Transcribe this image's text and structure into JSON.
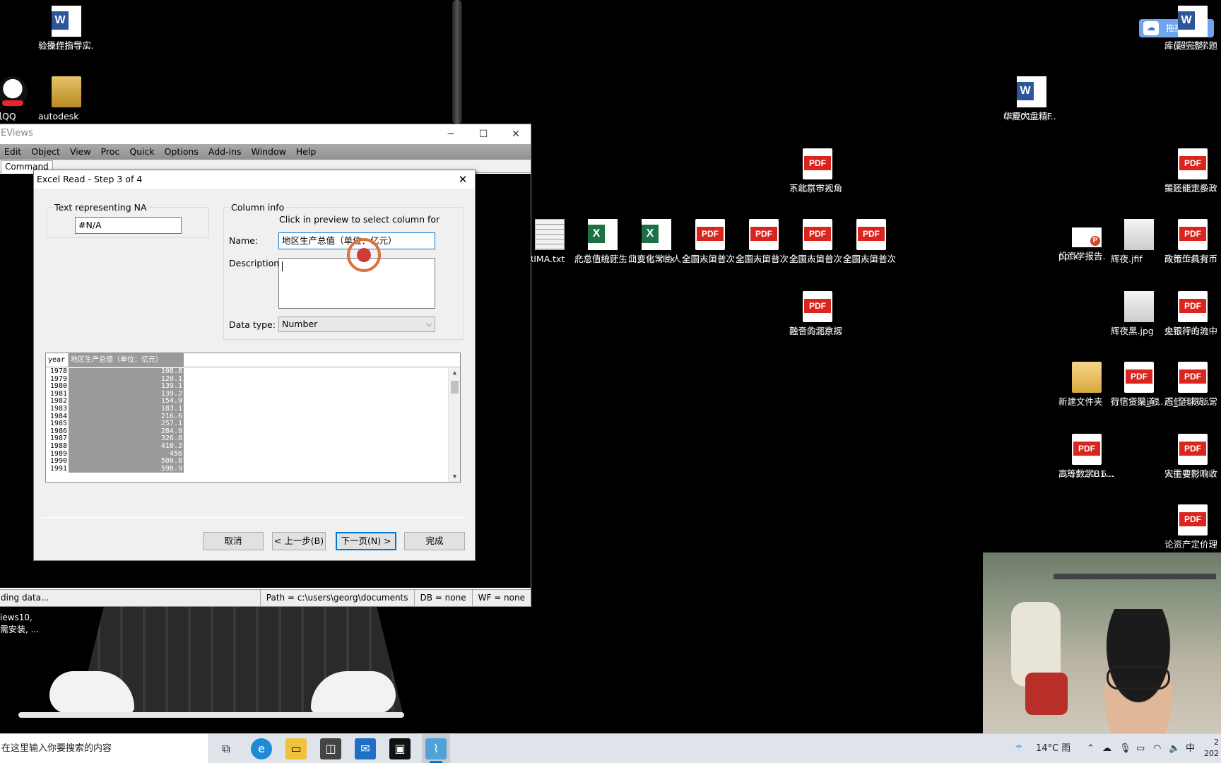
{
  "desktop": {
    "icons": [
      {
        "id": "word-lab-guide",
        "type": "word",
        "label_line1": "计量经济学实",
        "label_line2": "验操作指导...."
      },
      {
        "id": "qq",
        "type": "qq",
        "label_line1": "腾讯QQ",
        "label_line2": ""
      },
      {
        "id": "autodesk",
        "type": "folder2",
        "label_line1": "autodesk",
        "label_line2": ""
      },
      {
        "id": "word-000011",
        "type": "word",
        "label_line1": "000011.OF",
        "label_line2": "华夏大盘精..."
      },
      {
        "id": "pdf-systems",
        "type": "pdf",
        "label_line1": "系统科学视角",
        "label_line2": "下北京市人..."
      },
      {
        "id": "txt-arima",
        "type": "txt",
        "label_line1": "ARIMA.txt",
        "label_line2": ""
      },
      {
        "id": "xls-gdp",
        "type": "excel",
        "label_line1": "北京市地区生",
        "label_line2": "产总值统计..."
      },
      {
        "id": "xls-pop",
        "type": "excel",
        "label_line1": "北京市常住人",
        "label_line2": "口变化.xlsx"
      },
      {
        "id": "pdf-census1",
        "type": "pdf",
        "label_line1": "北京市第七次",
        "label_line2": "全国人口普..."
      },
      {
        "id": "pdf-census2",
        "type": "pdf",
        "label_line1": "北京市第七次",
        "label_line2": "全国人口普..."
      },
      {
        "id": "pdf-census3",
        "type": "pdf",
        "label_line1": "北京市第七次",
        "label_line2": "全国人口普..."
      },
      {
        "id": "pdf-census4",
        "type": "pdf",
        "label_line1": "北京市第七次",
        "label_line2": "全国人口普..."
      },
      {
        "id": "pdf-multisource",
        "type": "pdf",
        "label_line1": "基于多源数据",
        "label_line2": "融合的北京..."
      },
      {
        "id": "word-econ-bank",
        "type": "word",
        "label_line1": "计量经济学题",
        "label_line2": "库(超完整..."
      },
      {
        "id": "pdf-fed",
        "type": "pdf",
        "label_line1": "美联储宽松政",
        "label_line2": "策还能走多..."
      },
      {
        "id": "ppt-invest",
        "type": "ppt",
        "label_line1": "投资学报告.",
        "label_line2": "pptx"
      },
      {
        "id": "img-jfif",
        "type": "img",
        "label_line1": "辉夜.jfif",
        "label_line2": ""
      },
      {
        "id": "pdf-central",
        "type": "pdf",
        "label_line1": "央行传统货币",
        "label_line2": "政策工具有..."
      },
      {
        "id": "img-jpg",
        "type": "img",
        "label_line1": "辉夜黑.jpg",
        "label_line2": ""
      },
      {
        "id": "pdf-shock",
        "type": "pdf",
        "label_line1": "金融冲击与中",
        "label_line2": "央银行的流..."
      },
      {
        "id": "folder-new",
        "type": "folder",
        "label_line1": "新建文件夹",
        "label_line2": ""
      },
      {
        "id": "pdf-digital",
        "type": "pdf",
        "label_line1": "数字金融_银",
        "label_line2": "行信贷渠道..."
      },
      {
        "id": "pdf-lowrate",
        "type": "pdf",
        "label_line1": "超低利率新常",
        "label_line2": "态_全球货..."
      },
      {
        "id": "pdf-math",
        "type": "pdf",
        "label_line1": "2015-2016...",
        "label_line2": "高等数学B1..."
      },
      {
        "id": "pdf-anhui",
        "type": "pdf",
        "label_line1": "安徽省财政收",
        "label_line2": "入主要影响..."
      },
      {
        "id": "pdf-asset",
        "type": "pdf",
        "label_line1": "论资产定价理",
        "label_line2": ""
      }
    ],
    "upload_pill": "拖拽上传",
    "left_note_line1": "iews10,",
    "left_note_line2": "需安装, ..."
  },
  "eviews": {
    "title": "EViews",
    "menu": [
      "Edit",
      "Object",
      "View",
      "Proc",
      "Quick",
      "Options",
      "Add-ins",
      "Window",
      "Help"
    ],
    "command_tab": "Command",
    "status": {
      "message": "ding data...",
      "path": "Path = c:\\users\\georg\\documents",
      "db": "DB = none",
      "wf": "WF = none"
    }
  },
  "dialog": {
    "title": "Excel Read - Step 3 of 4",
    "na_group_label": "Text representing NA",
    "na_value": "#N/A",
    "column_group_label": "Column info",
    "column_hint": "Click in preview to select column for",
    "name_label": "Name:",
    "name_value": "地区生产总值（单位：亿元）",
    "description_label": "Description:",
    "description_value": "",
    "datatype_label": "Data type:",
    "datatype_value": "Number",
    "preview": {
      "headers": [
        "year",
        "地区生产总值（单位：亿元）"
      ],
      "rows": [
        [
          "1978",
          "108.8"
        ],
        [
          "1979",
          "120.1"
        ],
        [
          "1980",
          "139.1"
        ],
        [
          "1981",
          "139.2"
        ],
        [
          "1982",
          "154.9"
        ],
        [
          "1983",
          "183.1"
        ],
        [
          "1984",
          "216.6"
        ],
        [
          "1985",
          "257.1"
        ],
        [
          "1986",
          "284.9"
        ],
        [
          "1987",
          "326.8"
        ],
        [
          "1988",
          "410.2"
        ],
        [
          "1989",
          "456"
        ],
        [
          "1990",
          "500.8"
        ],
        [
          "1991",
          "598.9"
        ]
      ]
    },
    "buttons": {
      "cancel": "取消",
      "back": "< 上一步(B)",
      "next": "下一页(N) >",
      "finish": "完成"
    }
  },
  "taskbar": {
    "search_text": "在这里输入你要搜索的内容",
    "weather": "14°C 雨",
    "ime": "中",
    "clock_line1": "2",
    "clock_line2": "202"
  }
}
